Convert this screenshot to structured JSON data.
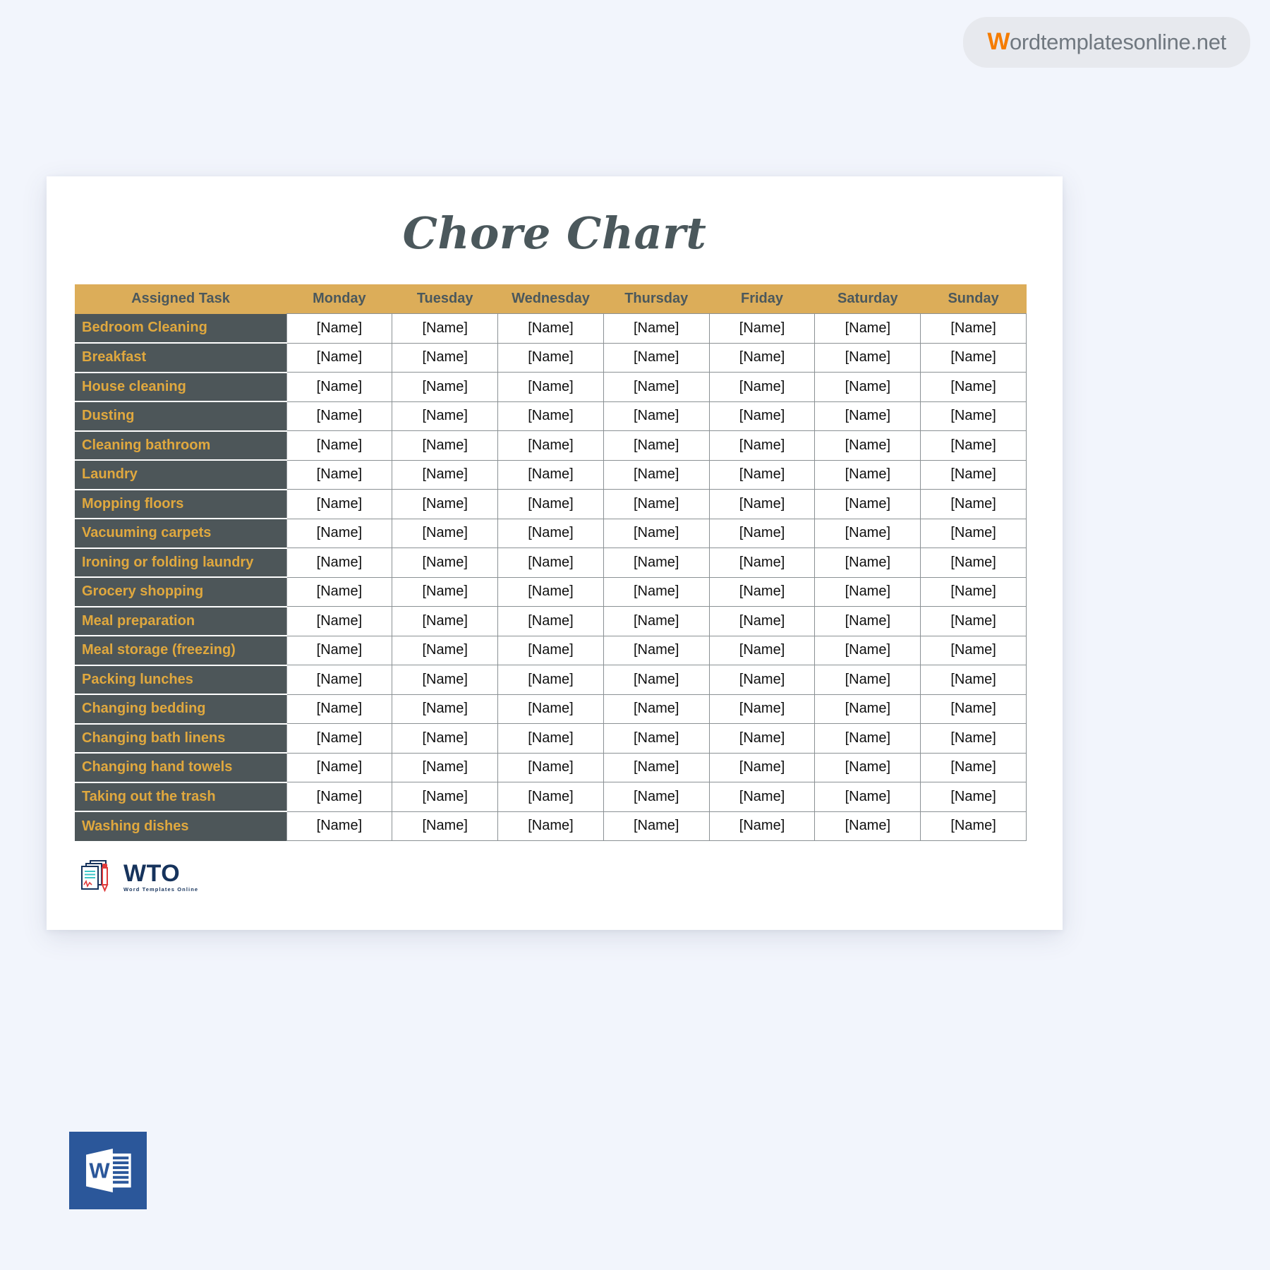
{
  "watermark": {
    "initial": "W",
    "rest": "ordtemplatesonline.net",
    "icon": "wordtemplatesonline-badge"
  },
  "document": {
    "title": "Chore Chart",
    "placeholder_value": "[Name]",
    "table": {
      "columns": [
        "Assigned Task",
        "Monday",
        "Tuesday",
        "Wednesday",
        "Thursday",
        "Friday",
        "Saturday",
        "Sunday"
      ],
      "rows": [
        {
          "task": "Bedroom Cleaning",
          "days": [
            "[Name]",
            "[Name]",
            "[Name]",
            "[Name]",
            "[Name]",
            "[Name]",
            "[Name]"
          ]
        },
        {
          "task": "Breakfast",
          "days": [
            "[Name]",
            "[Name]",
            "[Name]",
            "[Name]",
            "[Name]",
            "[Name]",
            "[Name]"
          ]
        },
        {
          "task": "House cleaning",
          "days": [
            "[Name]",
            "[Name]",
            "[Name]",
            "[Name]",
            "[Name]",
            "[Name]",
            "[Name]"
          ]
        },
        {
          "task": "Dusting",
          "days": [
            "[Name]",
            "[Name]",
            "[Name]",
            "[Name]",
            "[Name]",
            "[Name]",
            "[Name]"
          ]
        },
        {
          "task": "Cleaning bathroom",
          "days": [
            "[Name]",
            "[Name]",
            "[Name]",
            "[Name]",
            "[Name]",
            "[Name]",
            "[Name]"
          ]
        },
        {
          "task": "Laundry",
          "days": [
            "[Name]",
            "[Name]",
            "[Name]",
            "[Name]",
            "[Name]",
            "[Name]",
            "[Name]"
          ]
        },
        {
          "task": "Mopping floors",
          "days": [
            "[Name]",
            "[Name]",
            "[Name]",
            "[Name]",
            "[Name]",
            "[Name]",
            "[Name]"
          ]
        },
        {
          "task": "Vacuuming carpets",
          "days": [
            "[Name]",
            "[Name]",
            "[Name]",
            "[Name]",
            "[Name]",
            "[Name]",
            "[Name]"
          ]
        },
        {
          "task": "Ironing or folding laundry",
          "days": [
            "[Name]",
            "[Name]",
            "[Name]",
            "[Name]",
            "[Name]",
            "[Name]",
            "[Name]"
          ]
        },
        {
          "task": "Grocery shopping",
          "days": [
            "[Name]",
            "[Name]",
            "[Name]",
            "[Name]",
            "[Name]",
            "[Name]",
            "[Name]"
          ]
        },
        {
          "task": "Meal preparation",
          "days": [
            "[Name]",
            "[Name]",
            "[Name]",
            "[Name]",
            "[Name]",
            "[Name]",
            "[Name]"
          ]
        },
        {
          "task": "Meal storage (freezing)",
          "days": [
            "[Name]",
            "[Name]",
            "[Name]",
            "[Name]",
            "[Name]",
            "[Name]",
            "[Name]"
          ]
        },
        {
          "task": "Packing lunches",
          "days": [
            "[Name]",
            "[Name]",
            "[Name]",
            "[Name]",
            "[Name]",
            "[Name]",
            "[Name]"
          ]
        },
        {
          "task": "Changing bedding",
          "days": [
            "[Name]",
            "[Name]",
            "[Name]",
            "[Name]",
            "[Name]",
            "[Name]",
            "[Name]"
          ]
        },
        {
          "task": "Changing bath linens",
          "days": [
            "[Name]",
            "[Name]",
            "[Name]",
            "[Name]",
            "[Name]",
            "[Name]",
            "[Name]"
          ]
        },
        {
          "task": "Changing hand towels",
          "days": [
            "[Name]",
            "[Name]",
            "[Name]",
            "[Name]",
            "[Name]",
            "[Name]",
            "[Name]"
          ]
        },
        {
          "task": "Taking out the trash",
          "days": [
            "[Name]",
            "[Name]",
            "[Name]",
            "[Name]",
            "[Name]",
            "[Name]",
            "[Name]"
          ]
        },
        {
          "task": "Washing dishes",
          "days": [
            "[Name]",
            "[Name]",
            "[Name]",
            "[Name]",
            "[Name]",
            "[Name]",
            "[Name]"
          ]
        }
      ]
    },
    "logo": {
      "icon": "wto-document-pen-logo",
      "text": "WTO",
      "subtitle": "Word Templates Online"
    }
  },
  "word_icon": {
    "icon": "microsoft-word-icon",
    "letter": "W"
  },
  "colors": {
    "page_background": "#f2f5fc",
    "header_gold": "#dcad59",
    "task_slate": "#4d5659",
    "task_text_gold": "#e0a83e",
    "title_slate": "#4b585c",
    "watermark_orange": "#f57c00",
    "watermark_gray": "#707880",
    "logo_navy": "#16335c",
    "word_blue": "#2b579a"
  }
}
